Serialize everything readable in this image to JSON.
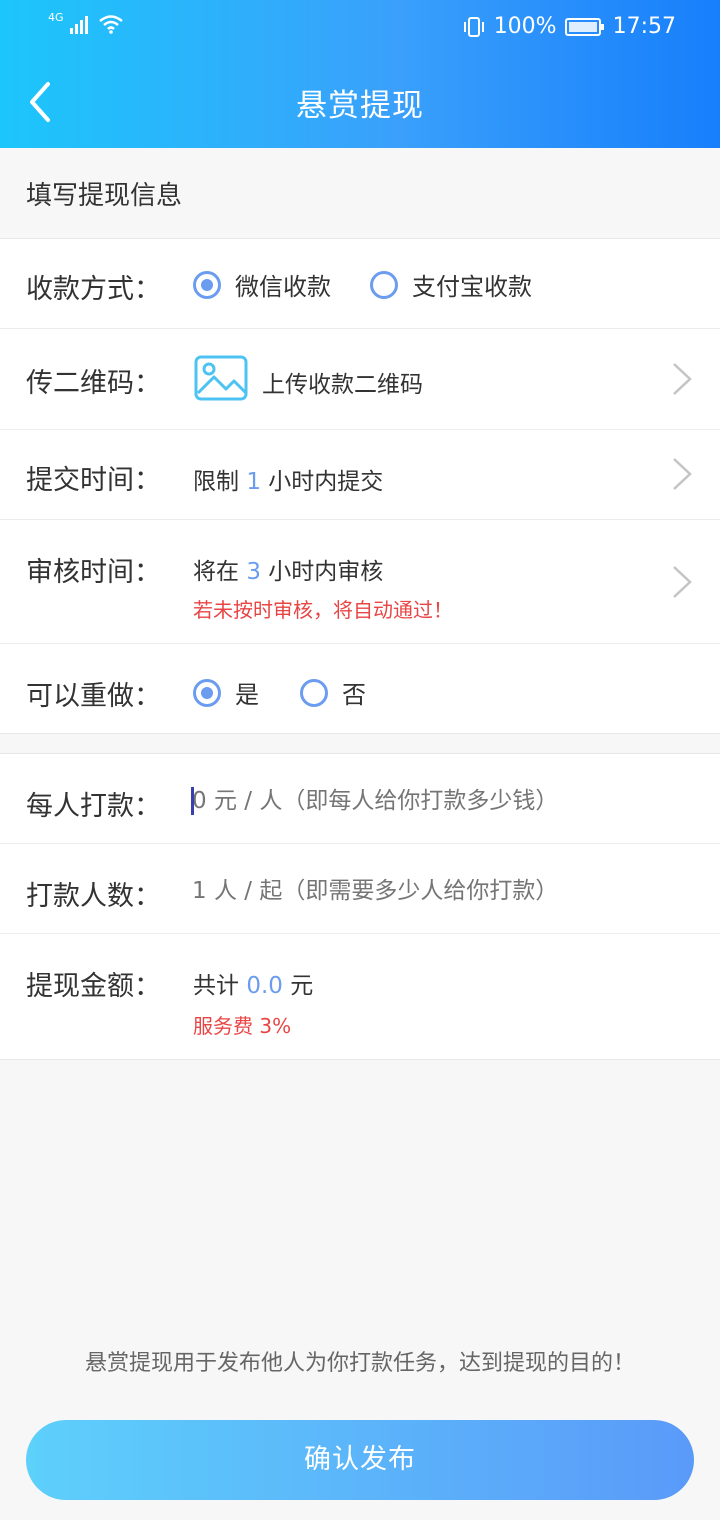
{
  "status": {
    "network": "4G",
    "battery": "100%",
    "time": "17:57"
  },
  "header": {
    "title": "悬赏提现"
  },
  "section": {
    "title": "填写提现信息"
  },
  "payment_method": {
    "label": "收款方式：",
    "options": [
      {
        "label": "微信收款",
        "selected": true
      },
      {
        "label": "支付宝收款",
        "selected": false
      }
    ]
  },
  "qr_code": {
    "label": "传二维码：",
    "upload_label": "上传收款二维码"
  },
  "submit_time": {
    "label": "提交时间：",
    "prefix": "限制",
    "value": "1",
    "suffix": "小时内提交"
  },
  "review_time": {
    "label": "审核时间：",
    "prefix": "将在",
    "value": "3",
    "suffix": "小时内审核",
    "warning": "若未按时审核，将自动通过！"
  },
  "redo": {
    "label": "可以重做：",
    "options": [
      {
        "label": "是",
        "selected": true
      },
      {
        "label": "否",
        "selected": false
      }
    ]
  },
  "per_person": {
    "label": "每人打款：",
    "placeholder": "0 元 / 人（即每人给你打款多少钱）"
  },
  "people_count": {
    "label": "打款人数：",
    "placeholder": "1 人 / 起（即需要多少人给你打款）"
  },
  "total": {
    "label": "提现金额：",
    "prefix": "共计",
    "value": "0.0",
    "suffix": "元",
    "fee": "服务费 3%"
  },
  "footer": {
    "note": "悬赏提现用于发布他人为你打款任务，达到提现的目的！",
    "submit_label": "确认发布"
  },
  "colors": {
    "accent": "#6b9cf0",
    "warning": "#e84545",
    "header_start": "#1cc6fb",
    "header_end": "#177ffb"
  }
}
